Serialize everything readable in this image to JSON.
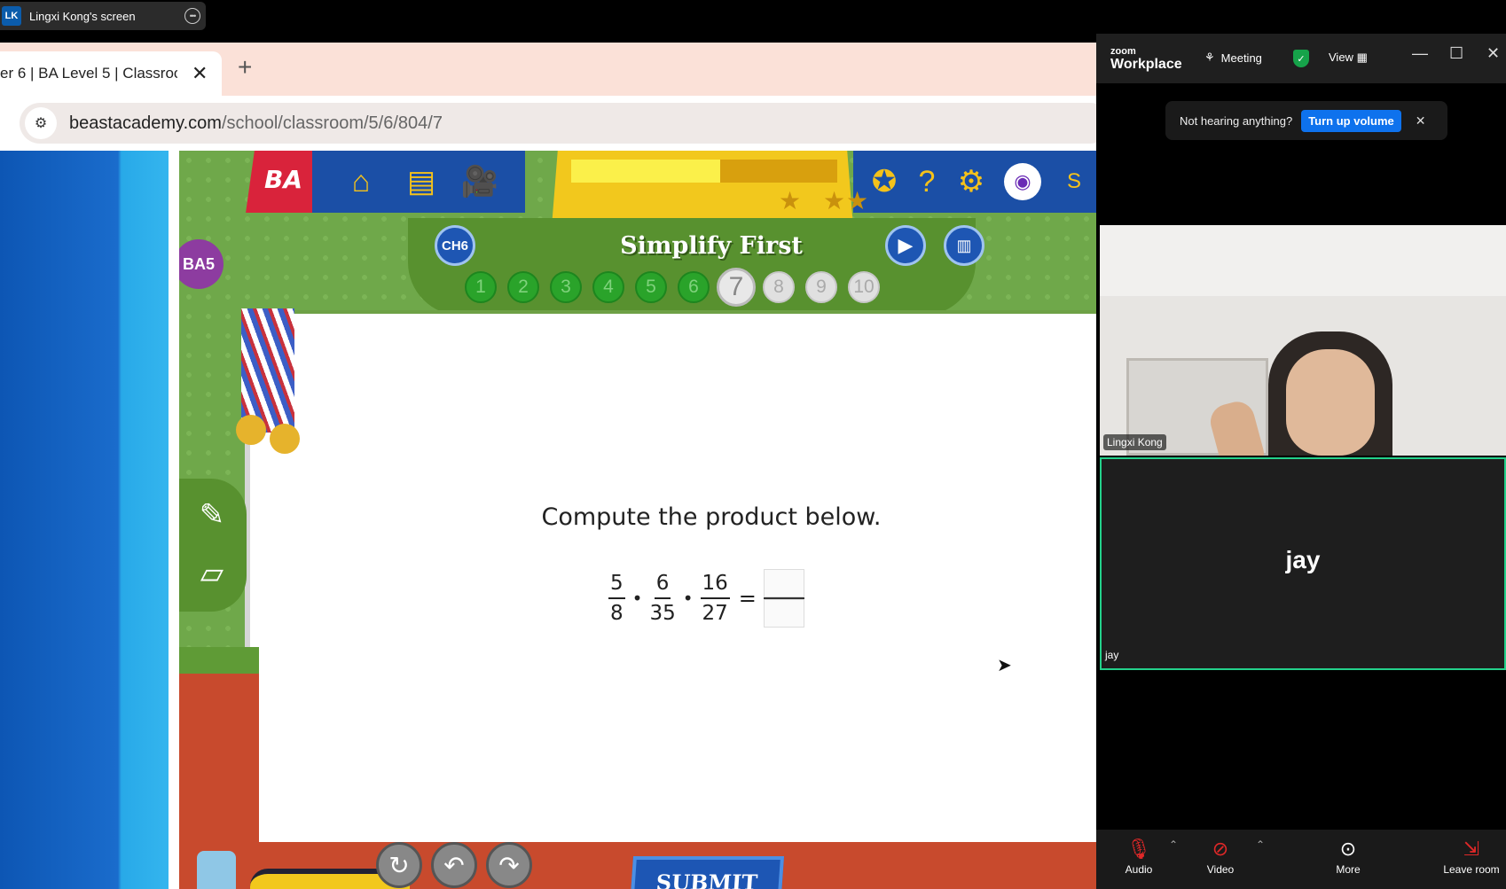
{
  "share": {
    "avatar_initials": "LK",
    "title": "Lingxi Kong's screen",
    "more_icon": "ellipsis-icon"
  },
  "browser": {
    "tab_title": "er 6 | BA Level 5 | Classroo",
    "tab_close": "✕",
    "new_tab": "+",
    "url_domain": "beastacademy.com",
    "url_path": "/school/classroom/5/6/804/7"
  },
  "game": {
    "logo": "BA",
    "level_badge": "BA5",
    "chapter_badge": "CH6",
    "lesson_title": "Simplify First",
    "progress_fraction": 0.56,
    "problems": [
      "1",
      "2",
      "3",
      "4",
      "5",
      "6",
      "7",
      "8",
      "9",
      "10"
    ],
    "completed_count": 6,
    "current_problem": "7",
    "question": "Compute the product below.",
    "fractions": [
      {
        "num": "5",
        "den": "8"
      },
      {
        "num": "6",
        "den": "35"
      },
      {
        "num": "16",
        "den": "27"
      }
    ],
    "dot": "•",
    "equals": "=",
    "submit_label": "SUBMIT",
    "top_icon_partial": "S"
  },
  "zoom": {
    "logo_small": "zoom",
    "logo_big": "Workplace",
    "meeting_label": "Meeting",
    "view_label": "View",
    "notice_text": "Not hearing anything?",
    "notice_button": "Turn up volume",
    "notice_close": "✕",
    "tile1_name": "Lingxi Kong",
    "tile2_big": "jay",
    "tile2_name": "jay",
    "toolbar": {
      "audio": "Audio",
      "video": "Video",
      "more": "More",
      "leave": "Leave room"
    },
    "accent": "#0e72ed",
    "active_speaker_color": "#23d18b"
  }
}
